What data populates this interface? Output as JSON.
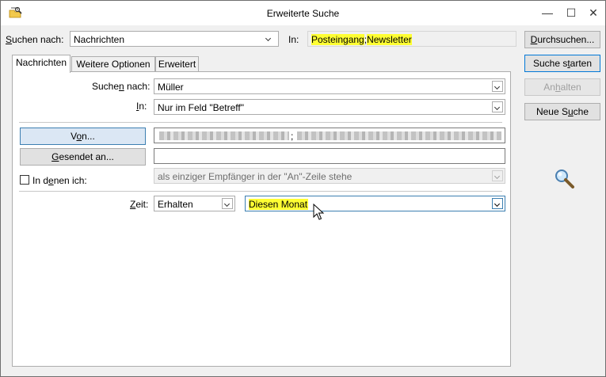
{
  "window": {
    "title": "Erweiterte Suche",
    "minimize_glyph": "—",
    "maximize_glyph": "☐",
    "close_glyph": "✕"
  },
  "search_for": {
    "label_underline": "S",
    "label_rest": "uchen nach:",
    "value": "Nachrichten"
  },
  "in_folder": {
    "label": "In:",
    "folder1": "Posteingang",
    "separator": ";",
    "folder2": "Newsletter",
    "highlight_color": "#ffff33"
  },
  "buttons": {
    "browse": {
      "underline": "D",
      "rest": "urchsuchen..."
    },
    "start": {
      "pre": "Suche s",
      "underline": "t",
      "post": "arten"
    },
    "stop": {
      "pre": "An",
      "underline": "h",
      "post": "alten"
    },
    "new": {
      "pre": "Neue S",
      "underline": "u",
      "post": "che"
    }
  },
  "tabs": [
    {
      "label": "Nachrichten",
      "active": true
    },
    {
      "label": "Weitere Optionen",
      "active": false
    },
    {
      "label": "Erweitert",
      "active": false
    }
  ],
  "form": {
    "search_words": {
      "pre": "Suche",
      "underline": "n",
      "post": " nach:",
      "value": "Müller"
    },
    "search_in": {
      "underline": "I",
      "post": "n:",
      "value": "Nur im Feld \"Betreff\""
    },
    "from_button": {
      "pre": "V",
      "underline": "o",
      "post": "n..."
    },
    "from_separator": ";",
    "sent_to_button": {
      "underline": "G",
      "post": "esendet an..."
    },
    "where_i_am": {
      "pre": "In d",
      "underline": "e",
      "post": "nen ich:",
      "value": "als einziger Empfänger in der \"An\"-Zeile stehe",
      "checked": false
    },
    "time": {
      "underline": "Z",
      "post": "eit:",
      "type_value": "Erhalten",
      "range_value": "Diesen Monat"
    }
  },
  "icons": {
    "app": "search-folder-icon",
    "search": "magnifier-icon"
  }
}
